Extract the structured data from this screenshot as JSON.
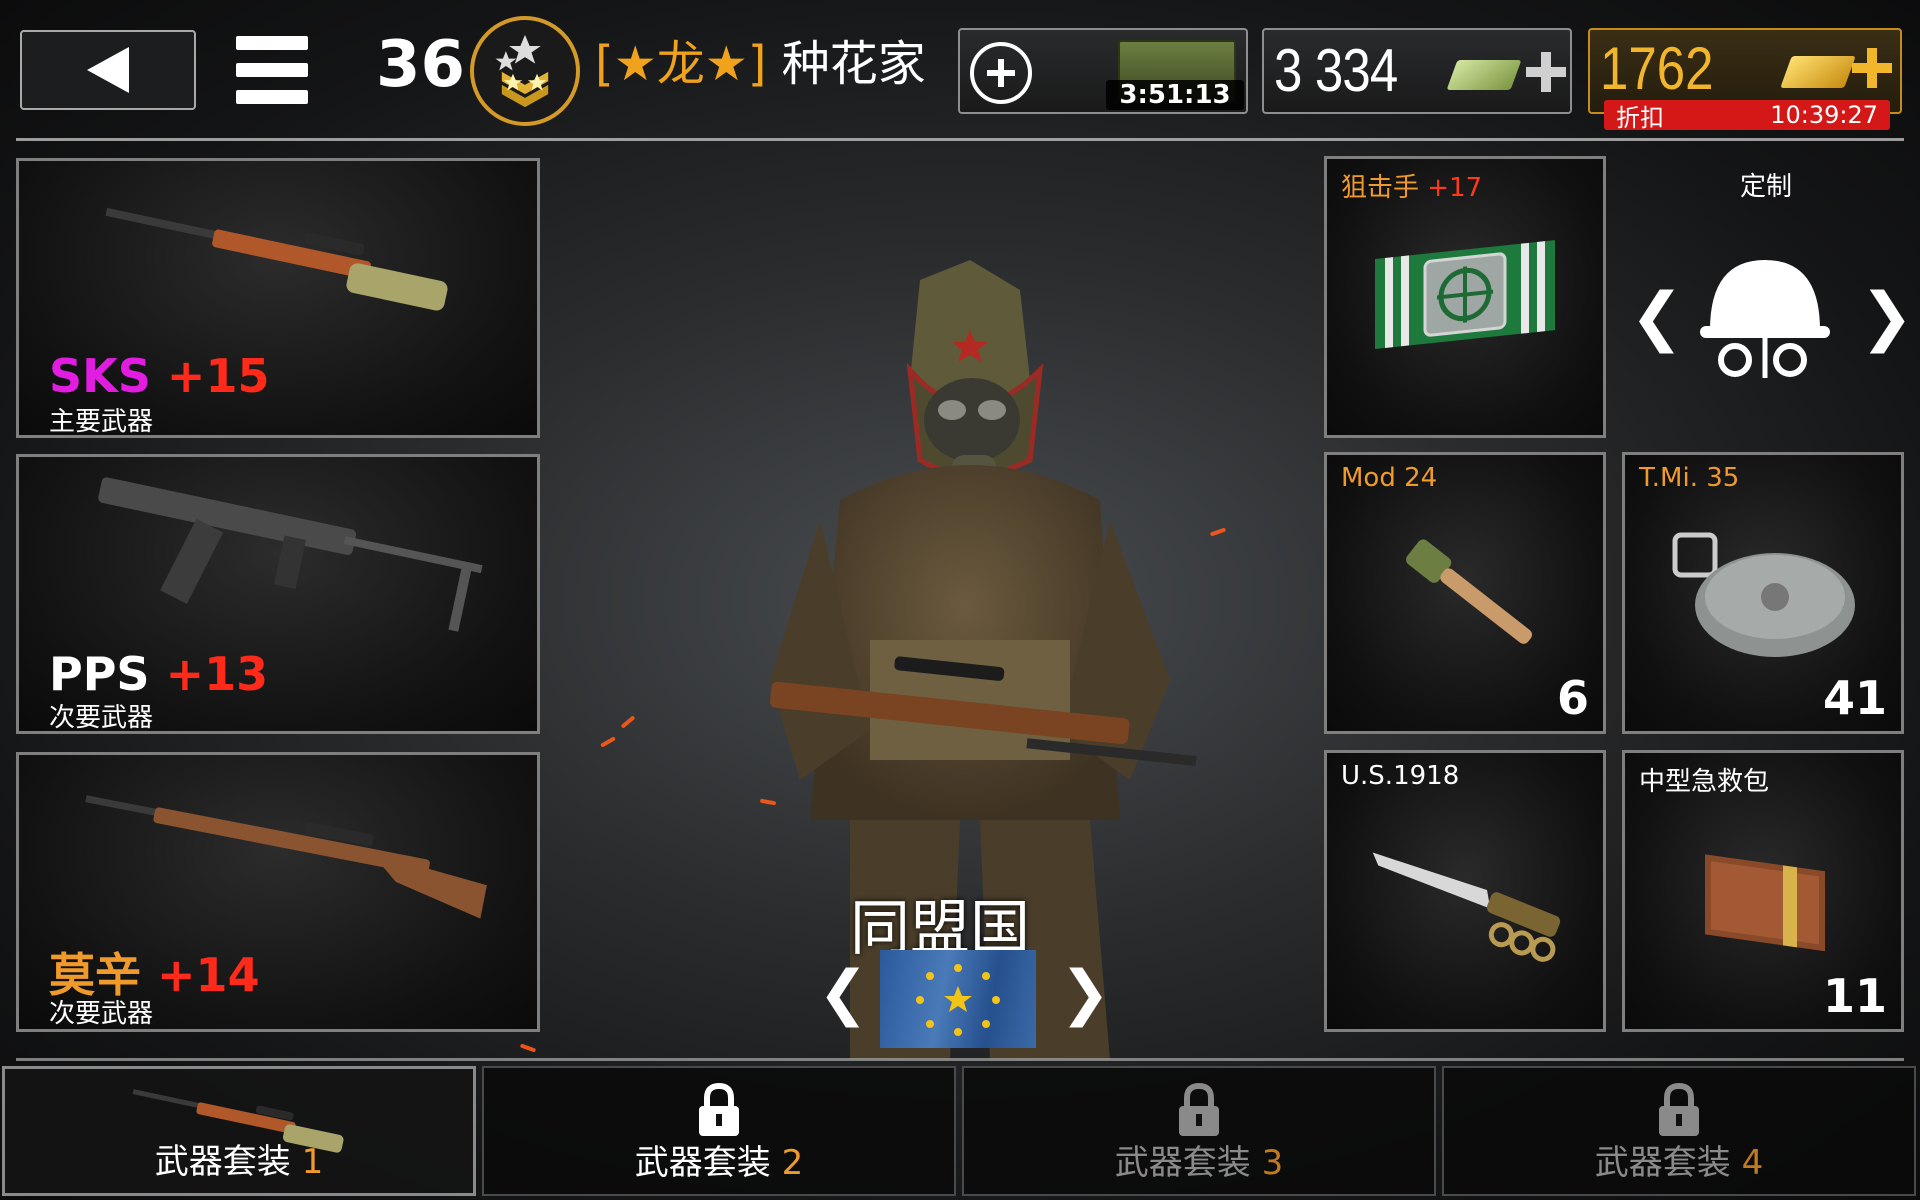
{
  "header": {
    "level": "36",
    "clan_tag": "[★龙★]",
    "player_name": "种花家",
    "crate_timer": "3:51:13",
    "silver": "3 334",
    "gold": "1762",
    "discount_label": "折扣",
    "discount_timer": "10:39:27"
  },
  "weapons": [
    {
      "name": "SKS",
      "level": "+15",
      "type": "主要武器",
      "name_color": "#e21ce0"
    },
    {
      "name": "PPS",
      "level": "+13",
      "type": "次要武器",
      "name_color": "#ffffff"
    },
    {
      "name": "莫辛",
      "level": "+14",
      "type": "次要武器",
      "name_color": "#f09a2c"
    }
  ],
  "gear": {
    "badge": {
      "title": "狙击手",
      "level": "+17"
    },
    "custom_label": "定制",
    "grenade": {
      "title": "Mod 24",
      "count": "6"
    },
    "mine": {
      "title": "T.Mi. 35",
      "count": "41"
    },
    "knife": {
      "title": "U.S.1918"
    },
    "medkit": {
      "title": "中型急救包",
      "count": "11"
    }
  },
  "faction": {
    "name": "同盟国"
  },
  "tabs": [
    {
      "label": "武器套装",
      "num": "1"
    },
    {
      "label": "武器套装",
      "num": "2"
    },
    {
      "label": "武器套装",
      "num": "3"
    },
    {
      "label": "武器套装",
      "num": "4"
    }
  ],
  "colors": {
    "accent": "#f09a2c",
    "level_red": "#ff2a1a",
    "gold": "#f2b62b",
    "discount": "#d41818"
  }
}
